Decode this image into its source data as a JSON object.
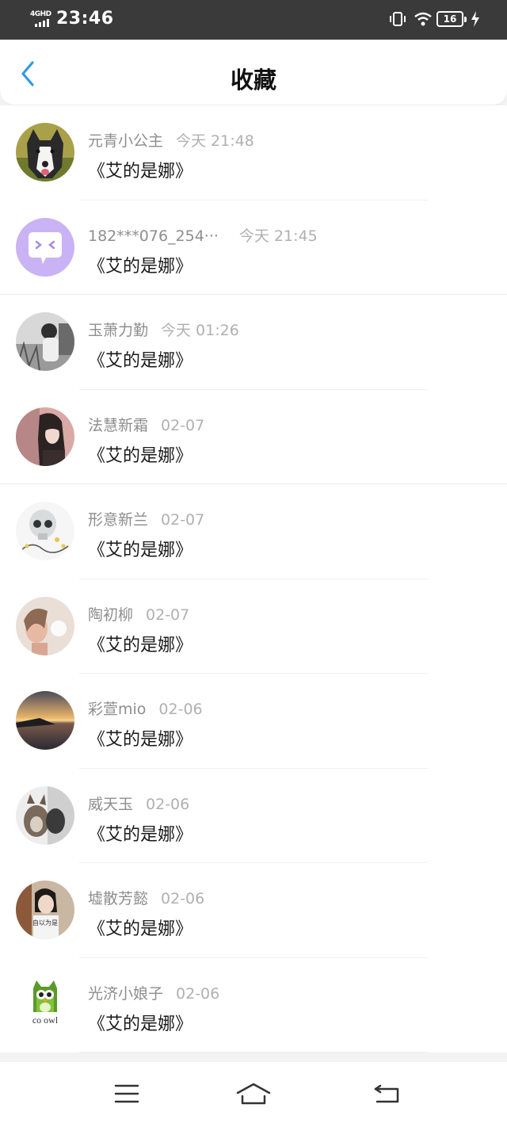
{
  "status_bar": {
    "network": "4GHD",
    "time": "23:46",
    "battery": "16"
  },
  "header": {
    "title": "收藏"
  },
  "items": [
    {
      "name": "元青小公主",
      "time": "今天 21:48",
      "title": "《艾的是娜》",
      "avatar": "dog-photo"
    },
    {
      "name": "182***076_254···",
      "time": "今天 21:45",
      "title": "《艾的是娜》",
      "avatar": "default-chat-avatar"
    },
    {
      "name": "玉萧力勤",
      "time": "今天 01:26",
      "title": "《艾的是娜》",
      "avatar": "bw-person-photo"
    },
    {
      "name": "法慧新霜",
      "time": "02-07",
      "title": "《艾的是娜》",
      "avatar": "anime-girl-photo"
    },
    {
      "name": "形意新兰",
      "time": "02-07",
      "title": "《艾的是娜》",
      "avatar": "skull-art-photo"
    },
    {
      "name": "陶初柳",
      "time": "02-07",
      "title": "《艾的是娜》",
      "avatar": "girl-dandelion-photo"
    },
    {
      "name": "彩萱mio",
      "time": "02-06",
      "title": "《艾的是娜》",
      "avatar": "sunset-lake-photo"
    },
    {
      "name": "威天玉",
      "time": "02-06",
      "title": "《艾的是娜》",
      "avatar": "cat-photo"
    },
    {
      "name": "墟散芳懿",
      "time": "02-06",
      "title": "《艾的是娜》",
      "avatar": "woman-portrait-photo",
      "avatar_caption": "自以为是"
    },
    {
      "name": "光济小娘子",
      "time": "02-06",
      "title": "《艾的是娜》",
      "avatar": "owl-logo",
      "avatar_caption": "co owl"
    }
  ],
  "colors": {
    "accent": "#2f9ae8",
    "name_text": "#8e8e8e",
    "time_text": "#b0b0b0",
    "default_avatar": "#c9b3f5"
  }
}
